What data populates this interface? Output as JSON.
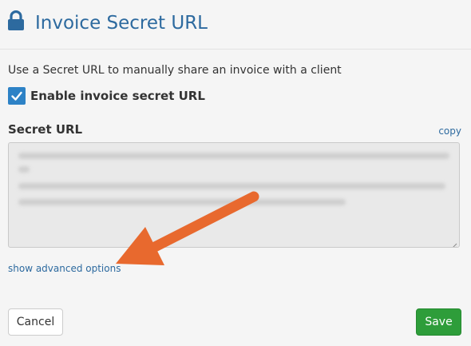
{
  "header": {
    "title": "Invoice Secret URL",
    "icon": "lock-icon"
  },
  "description": "Use a Secret URL to manually share an invoice with a client",
  "enable": {
    "label": "Enable invoice secret URL",
    "checked": true
  },
  "secret_url": {
    "label": "Secret URL",
    "copy_label": "copy"
  },
  "advanced_link": "show advanced options",
  "actions": {
    "cancel_label": "Cancel",
    "save_label": "Save"
  },
  "colors": {
    "title": "#2d6a9f",
    "link": "#2d6a9f",
    "checkbox": "#2d82c6",
    "save": "#2e9d3a",
    "arrow": "#e8692e"
  }
}
